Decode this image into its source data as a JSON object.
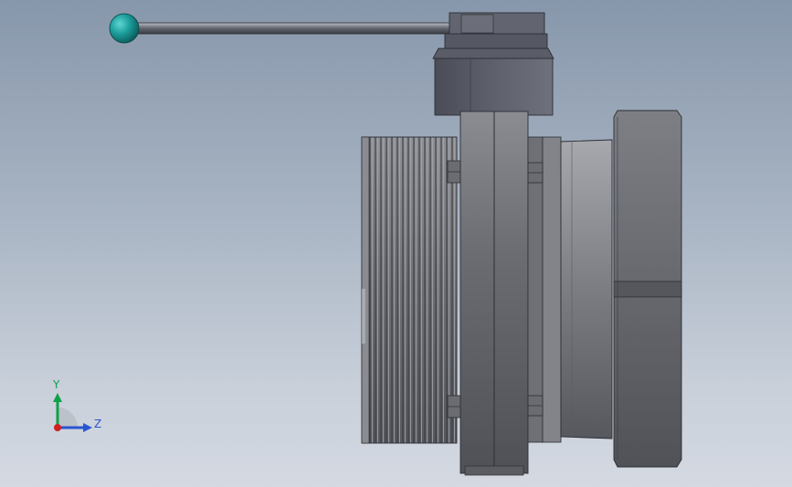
{
  "view": {
    "triad": {
      "y_label": "Y",
      "z_label": "Z",
      "y_color": "#0fa14a",
      "z_color": "#2a55d0",
      "x_color": "#d02020"
    },
    "colors": {
      "background_top": "#8797ab",
      "background_bottom": "#d4d9e2",
      "handle_knob": "#1a9c9a",
      "body_metal": "#5c5e66",
      "actuator": "#575a66"
    }
  }
}
